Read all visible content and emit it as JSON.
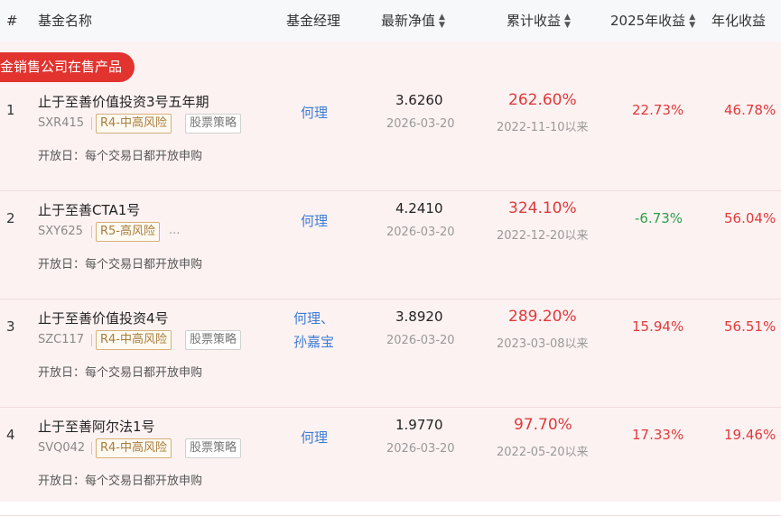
{
  "header": {
    "col_index": "#",
    "col_name": "基金名称",
    "col_manager": "基金经理",
    "col_nav": "最新净值",
    "col_cum": "累计收益",
    "col_2025": "2025年收益",
    "col_annual": "年化收益"
  },
  "banner": {
    "text": "金销售公司在售产品"
  },
  "colors": {
    "up": "#e0393a",
    "down": "#2aa04a",
    "link": "#3d7cd6",
    "banner": "#e2332f"
  },
  "rows": [
    {
      "index": "1",
      "name": "止于至善价值投资3号五年期",
      "code": "SXR415",
      "risk": "R4-中高风险",
      "strategy": "股票策略",
      "more": "",
      "open": "开放日：每个交易日都开放申购",
      "managers": [
        "何理"
      ],
      "nav": "3.6260",
      "nav_date": "2026-03-20",
      "cum_return": "262.60%",
      "since": "2022-11-10以来",
      "y2025": "22.73%",
      "y2025_dir": "up",
      "annual": "46.78%"
    },
    {
      "index": "2",
      "name": "止于至善CTA1号",
      "code": "SXY625",
      "risk": "R5-高风险",
      "strategy": "",
      "more": "...",
      "open": "开放日：每个交易日都开放申购",
      "managers": [
        "何理"
      ],
      "nav": "4.2410",
      "nav_date": "2026-03-20",
      "cum_return": "324.10%",
      "since": "2022-12-20以来",
      "y2025": "-6.73%",
      "y2025_dir": "down",
      "annual": "56.04%"
    },
    {
      "index": "3",
      "name": "止于至善价值投资4号",
      "code": "SZC117",
      "risk": "R4-中高风险",
      "strategy": "股票策略",
      "more": "",
      "open": "开放日：每个交易日都开放申购",
      "managers": [
        "何理、",
        "孙嘉宝"
      ],
      "nav": "3.8920",
      "nav_date": "2026-03-20",
      "cum_return": "289.20%",
      "since": "2023-03-08以来",
      "y2025": "15.94%",
      "y2025_dir": "up",
      "annual": "56.51%"
    },
    {
      "index": "4",
      "name": "止于至善阿尔法1号",
      "code": "SVQ042",
      "risk": "R4-中高风险",
      "strategy": "股票策略",
      "more": "",
      "open": "开放日：每个交易日都开放申购",
      "managers": [
        "何理"
      ],
      "nav": "1.9770",
      "nav_date": "2026-03-20",
      "cum_return": "97.70%",
      "since": "2022-05-20以来",
      "y2025": "17.33%",
      "y2025_dir": "up",
      "annual": "19.46%"
    }
  ]
}
